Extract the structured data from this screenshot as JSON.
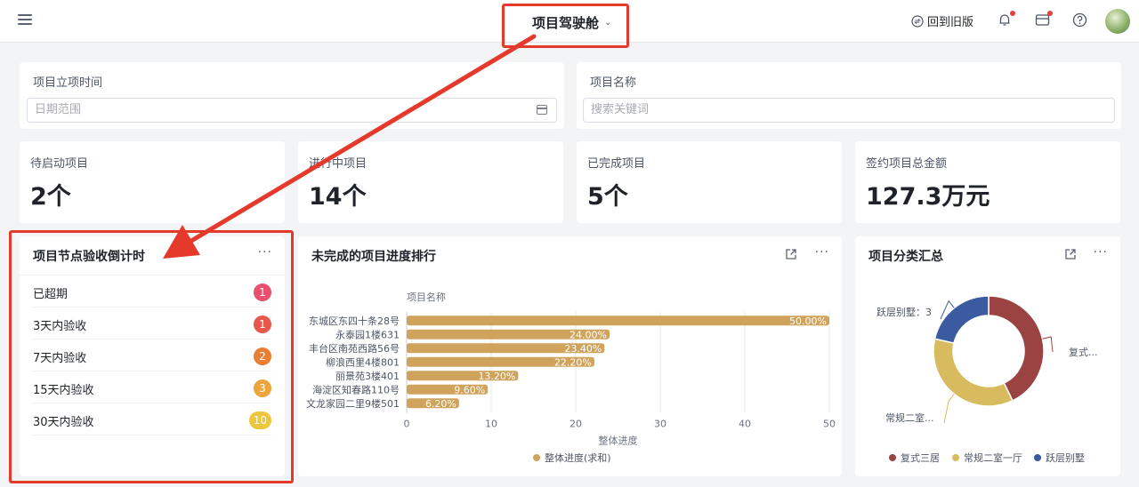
{
  "header": {
    "title": "项目驾驶舱",
    "back_old_label": "回到旧版"
  },
  "filters": {
    "date": {
      "label": "项目立项时间",
      "placeholder": "日期范围"
    },
    "name": {
      "label": "项目名称",
      "placeholder": "搜索关键词"
    }
  },
  "kpis": [
    {
      "label": "待启动项目",
      "value": "2个"
    },
    {
      "label": "进行中项目",
      "value": "14个"
    },
    {
      "label": "已完成项目",
      "value": "5个"
    },
    {
      "label": "签约项目总金额",
      "value": "127.3万元"
    }
  ],
  "countdown": {
    "title": "项目节点验收倒计时",
    "rows": [
      {
        "label": "已超期",
        "count": "1",
        "color": "#e8506e"
      },
      {
        "label": "3天内验收",
        "count": "1",
        "color": "#e8584a"
      },
      {
        "label": "7天内验收",
        "count": "2",
        "color": "#ec7e34"
      },
      {
        "label": "15天内验收",
        "count": "3",
        "color": "#eda43a"
      },
      {
        "label": "30天内验收",
        "count": "10",
        "color": "#eec63c"
      }
    ]
  },
  "progress_panel": {
    "title": "未完成的项目进度排行"
  },
  "category_panel": {
    "title": "项目分类汇总"
  },
  "chart_data": [
    {
      "type": "bar",
      "orientation": "horizontal",
      "ylabel": "项目名称",
      "xlabel": "整体进度",
      "categories": [
        "东城区东四十条28号",
        "永泰园1楼631",
        "丰台区南苑西路56号",
        "柳浪西里4楼801",
        "丽景苑3楼401",
        "海淀区知春路110号",
        "文龙家园二里9楼501"
      ],
      "series": [
        {
          "name": "整体进度(求和)",
          "values": [
            50.0,
            24.0,
            23.4,
            22.2,
            13.2,
            9.6,
            6.2
          ],
          "color": "#d0a35d"
        }
      ],
      "data_labels": [
        "50.00%",
        "24.00%",
        "23.40%",
        "22.20%",
        "13.20%",
        "9.60%",
        "6.20%"
      ],
      "xlim": [
        0,
        50
      ],
      "xticks": [
        0,
        10,
        20,
        30,
        40,
        50
      ],
      "grid": true,
      "legend": "bottom"
    },
    {
      "type": "pie",
      "donut": true,
      "categories": [
        "复式三居",
        "常规二室一厅",
        "跃层别墅"
      ],
      "values": [
        6,
        5,
        3
      ],
      "colors": [
        "#9b4242",
        "#d8bb5e",
        "#3c5aa0"
      ],
      "slice_labels": [
        "复式...",
        "常规二室...",
        "跃层别墅：3"
      ],
      "legend": "bottom"
    }
  ]
}
